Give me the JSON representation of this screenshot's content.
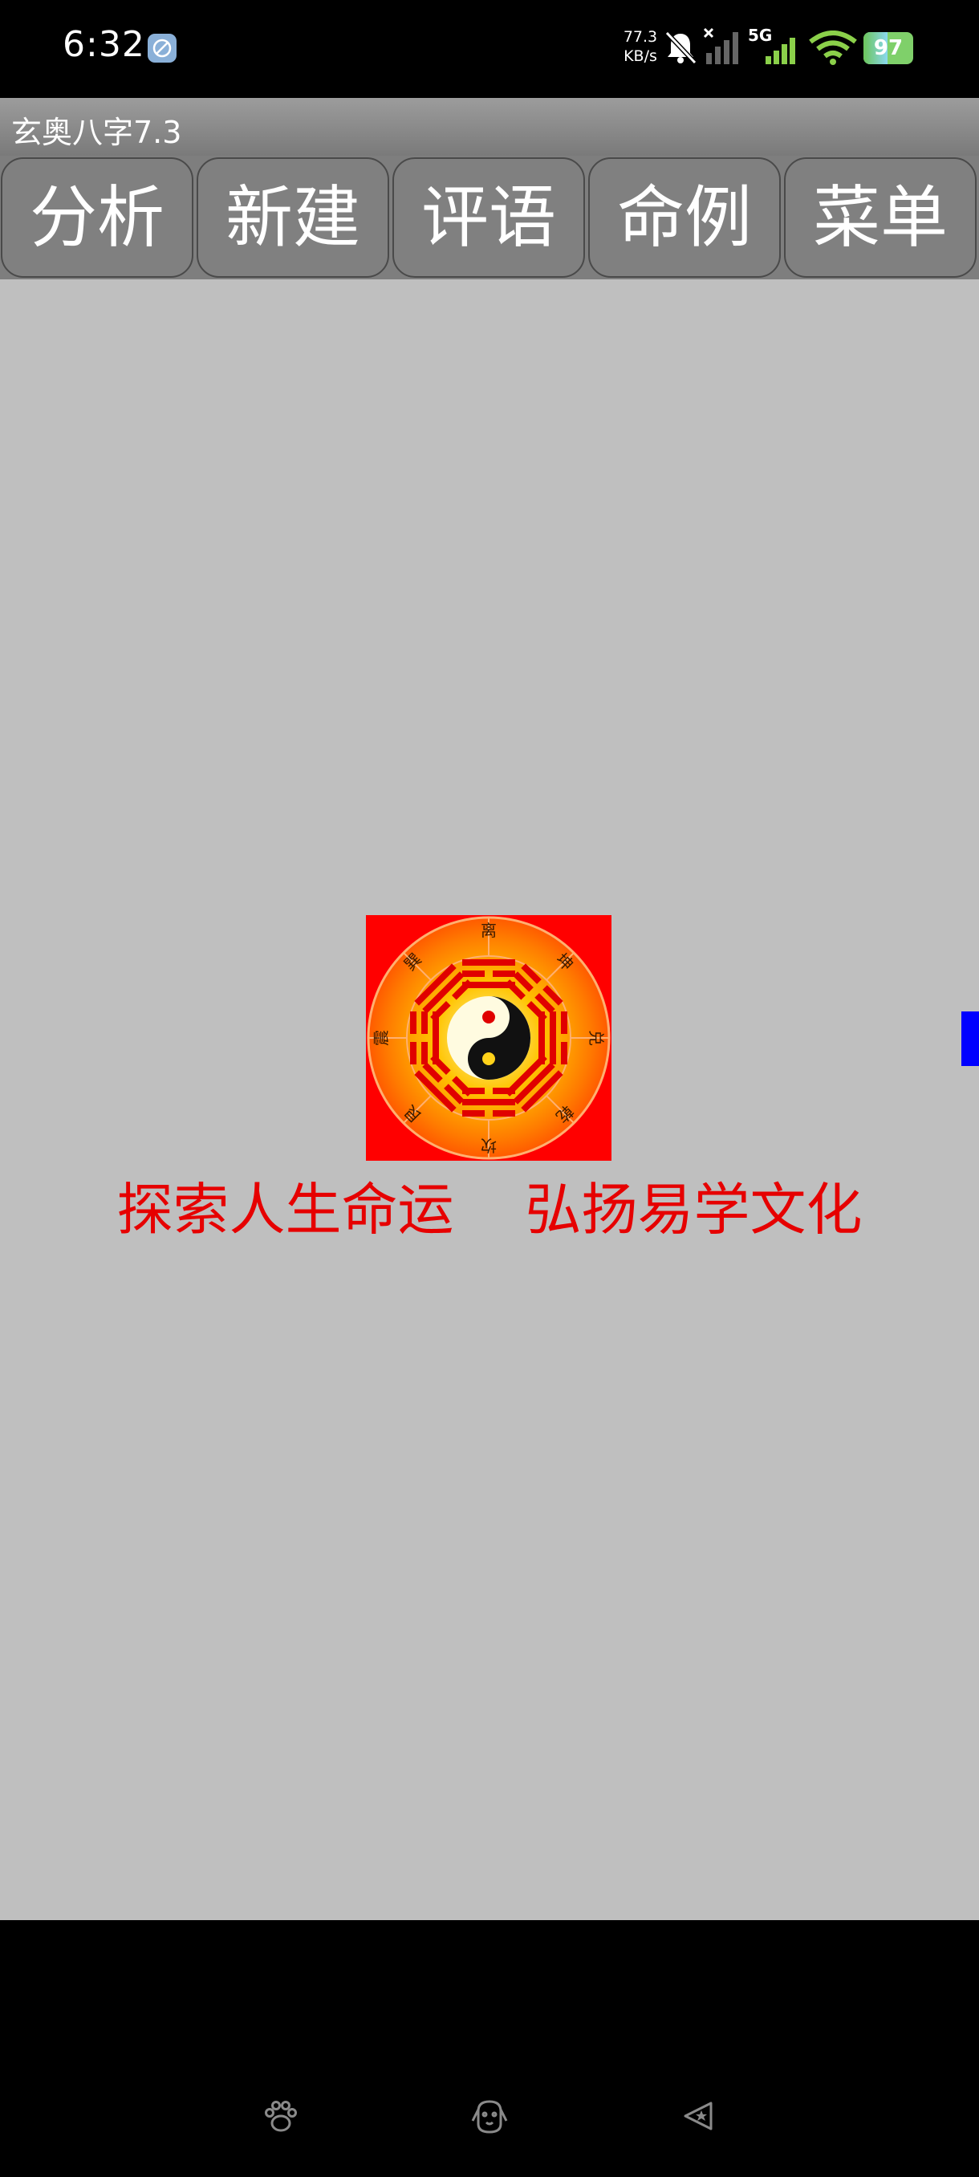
{
  "status_bar": {
    "time": "6:32",
    "network_speed_value": "77.3",
    "network_speed_unit": "KB/s",
    "network_type": "5G",
    "battery": "97",
    "icons": [
      "app-notification-icon",
      "mute-icon",
      "signal-no-service-icon",
      "signal-5g-icon",
      "wifi-icon",
      "battery-icon"
    ]
  },
  "app": {
    "title": "玄奥八字7.3"
  },
  "toolbar": {
    "buttons": [
      "分析",
      "新建",
      "评语",
      "命例",
      "菜单"
    ]
  },
  "main": {
    "logo_icon": "bagua-taiji-icon",
    "logo_trigrams": [
      "离",
      "坤",
      "兑",
      "乾",
      "坎",
      "艮",
      "震",
      "巽"
    ],
    "slogan": "探索人生命运    弘扬易学文化"
  },
  "nav_bar": {
    "keys": [
      "paw-icon",
      "dog-face-icon",
      "star-back-icon"
    ]
  },
  "colors": {
    "title_bar": "#8a8a8a",
    "button_bg": "#808080",
    "content_bg": "#bfbfbf",
    "slogan": "#e60000",
    "side_tab": "#0000ff",
    "battery": "#7fd06a"
  }
}
